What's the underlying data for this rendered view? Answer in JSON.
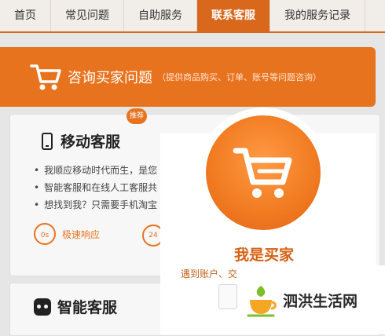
{
  "tabs": [
    {
      "label": "首页"
    },
    {
      "label": "常见问题"
    },
    {
      "label": "自助服务"
    },
    {
      "label": "联系客服",
      "active": true
    },
    {
      "label": "我的服务记录"
    }
  ],
  "banner": {
    "title": "咨询买家问题",
    "subtitle": "（提供商品购买、订单、账号等问题咨询）",
    "icon": "shopping-cart-icon",
    "color": "#e8731f"
  },
  "mobile_service": {
    "title": "移动客服",
    "badge": "推荐",
    "bullets": [
      "我顺应移动时代而生，是您",
      "智能客服和在线人工客服共",
      "想找到我？只需要手机淘宝"
    ],
    "stopwatch_text": "0s",
    "speed_label": "极速响应",
    "clock_text": "24"
  },
  "smart_service": {
    "title": "智能客服"
  },
  "popup": {
    "title": "我是买家",
    "subtitle": "遇到账户、交",
    "icon": "shopping-cart-icon",
    "color": "#f07a20"
  },
  "watermark": {
    "text": "泗洪生活网"
  }
}
